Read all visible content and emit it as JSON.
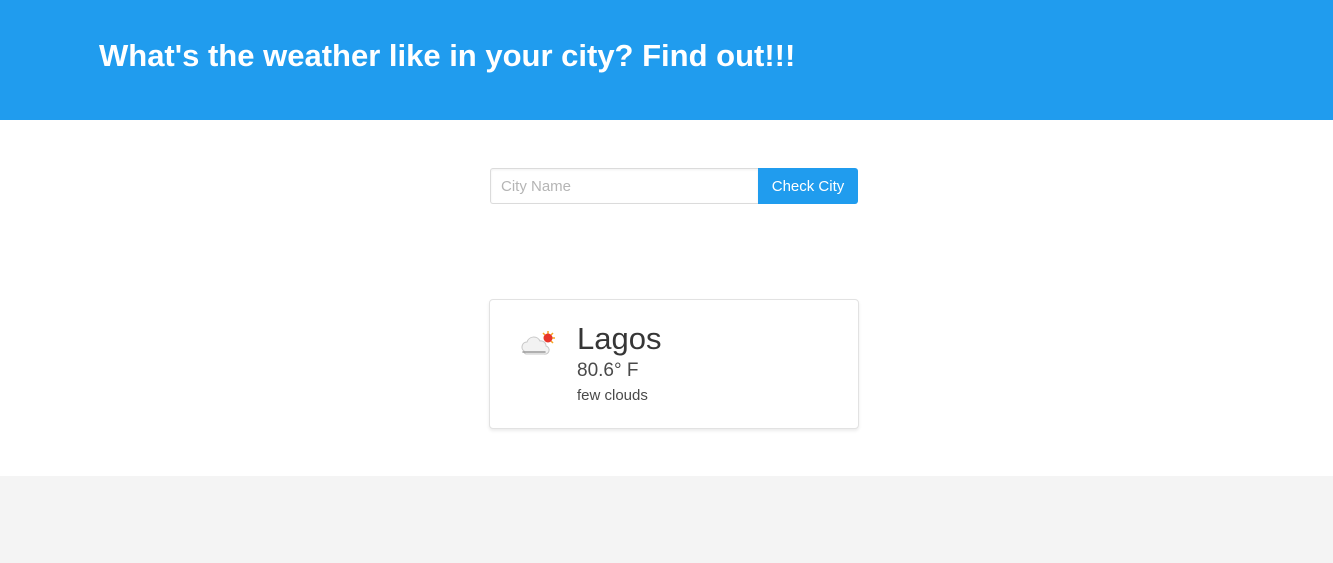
{
  "hero": {
    "title": "What's the weather like in your city? Find out!!!",
    "background_color": "#209cee"
  },
  "search": {
    "placeholder": "City Name",
    "value": "",
    "button_label": "Check City"
  },
  "weather": {
    "city": "Lagos",
    "temperature": "80.6° F",
    "description": "few clouds",
    "icon": "few-clouds-icon"
  }
}
